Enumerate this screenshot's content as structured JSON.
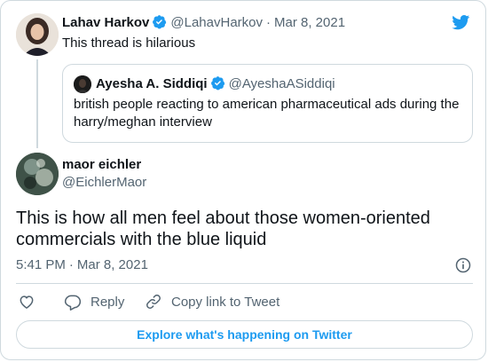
{
  "colors": {
    "accent": "#1d9bf0",
    "text": "#0f1419",
    "muted": "#536471",
    "border": "#cfd9de"
  },
  "tweet_parent": {
    "author_name": "Lahav Harkov",
    "handle": "@LahavHarkov",
    "separator": "·",
    "date": "Mar 8, 2021",
    "text": "This thread is hilarious",
    "verified_icon": "verified-badge-icon"
  },
  "quoted_tweet": {
    "author_name": "Ayesha A. Siddiqi",
    "handle": "@AyeshaASiddiqi",
    "text": "british people reacting to american pharmaceutical ads during the harry/meghan interview",
    "verified_icon": "verified-badge-icon"
  },
  "tweet_main": {
    "author_name": "maor eichler",
    "handle": "@EichlerMaor",
    "text": "This is how all men feel about those women-oriented commercials with the blue liquid",
    "time": "5:41 PM",
    "separator": "·",
    "date": "Mar 8, 2021"
  },
  "actions": {
    "like_icon": "heart-icon",
    "reply_label": "Reply",
    "copy_label": "Copy link to Tweet"
  },
  "explore_label": "Explore what's happening on Twitter",
  "logo_icon": "twitter-bird-icon"
}
